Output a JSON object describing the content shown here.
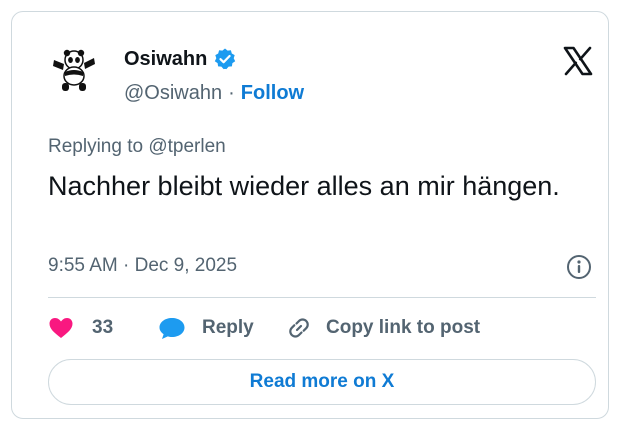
{
  "author": {
    "name": "Osiwahn",
    "handle": "@Osiwahn",
    "separator": "·",
    "follow_label": "Follow"
  },
  "tweet": {
    "replying_to": "Replying to @tperlen",
    "text": "Nachher bleibt wieder alles an mir hängen.",
    "timestamp": "9:55 AM · Dec 9, 2025"
  },
  "actions": {
    "like_count": "33",
    "reply_label": "Reply",
    "copy_label": "Copy link to post"
  },
  "footer": {
    "read_more_label": "Read more on X"
  },
  "icons": {
    "verified": "verified-badge-icon",
    "x_logo": "x-logo-icon",
    "info": "info-icon",
    "heart": "heart-icon",
    "reply": "reply-bubble-icon",
    "link": "link-icon"
  },
  "colors": {
    "accent": "#0f7bd4",
    "like": "#f91880",
    "reply_bubble": "#1d9bf0",
    "muted": "#536471",
    "border": "#cfd9de"
  }
}
